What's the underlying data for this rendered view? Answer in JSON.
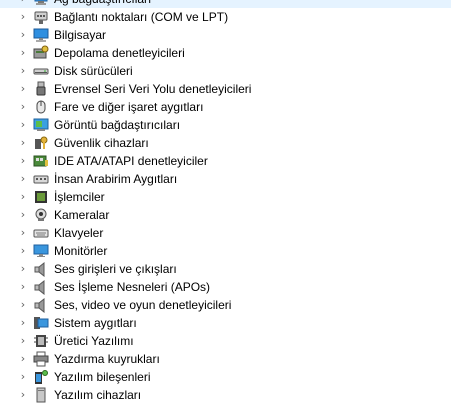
{
  "device_tree": {
    "items": [
      {
        "label": "Ağ bağdaştırıcıları",
        "icon": "network-adapter-icon"
      },
      {
        "label": "Bağlantı noktaları (COM ve LPT)",
        "icon": "port-icon"
      },
      {
        "label": "Bilgisayar",
        "icon": "computer-icon"
      },
      {
        "label": "Depolama denetleyicileri",
        "icon": "storage-controller-icon"
      },
      {
        "label": "Disk sürücüleri",
        "icon": "disk-drive-icon"
      },
      {
        "label": "Evrensel Seri Veri Yolu denetleyicileri",
        "icon": "usb-icon"
      },
      {
        "label": "Fare ve diğer işaret aygıtları",
        "icon": "mouse-icon"
      },
      {
        "label": "Görüntü bağdaştırıcıları",
        "icon": "display-adapter-icon"
      },
      {
        "label": "Güvenlik cihazları",
        "icon": "security-device-icon"
      },
      {
        "label": "IDE ATA/ATAPI denetleyiciler",
        "icon": "ide-controller-icon"
      },
      {
        "label": "İnsan Arabirim Aygıtları",
        "icon": "hid-icon"
      },
      {
        "label": "İşlemciler",
        "icon": "processor-icon"
      },
      {
        "label": "Kameralar",
        "icon": "camera-icon"
      },
      {
        "label": "Klavyeler",
        "icon": "keyboard-icon"
      },
      {
        "label": "Monitörler",
        "icon": "monitor-icon"
      },
      {
        "label": "Ses girişleri ve çıkışları",
        "icon": "speaker-icon"
      },
      {
        "label": "Ses İşleme Nesneleri (APOs)",
        "icon": "speaker-icon"
      },
      {
        "label": "Ses, video ve oyun denetleyicileri",
        "icon": "speaker-icon"
      },
      {
        "label": "Sistem aygıtları",
        "icon": "system-device-icon"
      },
      {
        "label": "Üretici Yazılımı",
        "icon": "firmware-icon"
      },
      {
        "label": "Yazdırma kuyrukları",
        "icon": "printer-icon"
      },
      {
        "label": "Yazılım bileşenleri",
        "icon": "software-component-icon"
      },
      {
        "label": "Yazılım cihazları",
        "icon": "software-device-icon"
      }
    ],
    "expander_glyph": "›"
  }
}
